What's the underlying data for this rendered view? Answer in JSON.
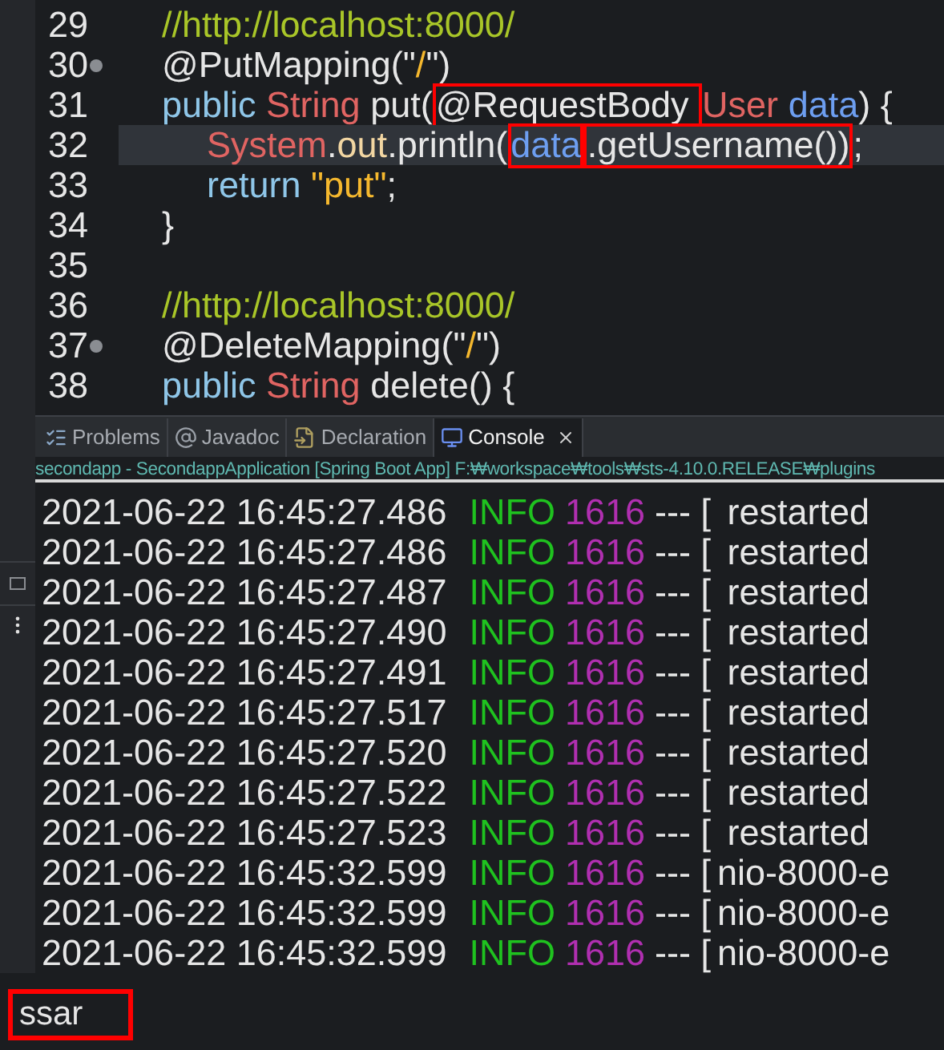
{
  "editor": {
    "lines": [
      {
        "number": "29",
        "fold": false,
        "current": false,
        "kind": "member",
        "tokens": [
          {
            "kind": "comment",
            "text": "//http://localhost:8000/",
            "boxed": false
          }
        ]
      },
      {
        "number": "30",
        "fold": true,
        "current": false,
        "kind": "member",
        "tokens": [
          {
            "kind": "plain",
            "text": "@PutMapping(",
            "boxed": false
          },
          {
            "kind": "plain",
            "text": "\"",
            "boxed": false
          },
          {
            "kind": "literal",
            "text": "/",
            "boxed": false
          },
          {
            "kind": "plain",
            "text": "\")",
            "boxed": false
          }
        ]
      },
      {
        "number": "31",
        "fold": false,
        "current": false,
        "kind": "member",
        "tokens": [
          {
            "kind": "keyword",
            "text": "public ",
            "boxed": false
          },
          {
            "kind": "type",
            "text": "String ",
            "boxed": false
          },
          {
            "kind": "plain",
            "text": "put(",
            "boxed": false
          },
          {
            "kind": "plain",
            "text": "@RequestBody ",
            "boxed": true
          },
          {
            "kind": "type",
            "text": "User ",
            "boxed": false
          },
          {
            "kind": "variable",
            "text": "data",
            "boxed": false
          },
          {
            "kind": "plain",
            "text": ") {",
            "boxed": false
          }
        ]
      },
      {
        "number": "32",
        "fold": false,
        "current": true,
        "kind": "statement",
        "tokens": [
          {
            "kind": "type",
            "text": "System",
            "boxed": false
          },
          {
            "kind": "plain",
            "text": ".",
            "boxed": false
          },
          {
            "kind": "field",
            "text": "out",
            "boxed": false
          },
          {
            "kind": "plain",
            "text": ".println(",
            "boxed": false
          },
          {
            "kind": "variable",
            "text": "data",
            "boxed": true
          },
          {
            "kind": "plain",
            "text": ".getUsername())",
            "boxed": true
          },
          {
            "kind": "plain",
            "text": ";",
            "boxed": false
          }
        ]
      },
      {
        "number": "33",
        "fold": false,
        "current": false,
        "kind": "statement",
        "tokens": [
          {
            "kind": "keyword",
            "text": "return ",
            "boxed": false
          },
          {
            "kind": "literal",
            "text": "\"put\"",
            "boxed": false
          },
          {
            "kind": "plain",
            "text": ";",
            "boxed": false
          }
        ]
      },
      {
        "number": "34",
        "fold": false,
        "current": false,
        "kind": "member",
        "tokens": [
          {
            "kind": "plain",
            "text": "}",
            "boxed": false
          }
        ]
      },
      {
        "number": "35",
        "fold": false,
        "current": false,
        "kind": "member"
      },
      {
        "number": "36",
        "fold": false,
        "current": false,
        "kind": "member",
        "tokens": [
          {
            "kind": "comment",
            "text": "//http://localhost:8000/",
            "boxed": false
          }
        ]
      },
      {
        "number": "37",
        "fold": true,
        "current": false,
        "kind": "member",
        "tokens": [
          {
            "kind": "plain",
            "text": "@DeleteMapping(",
            "boxed": false
          },
          {
            "kind": "plain",
            "text": "\"",
            "boxed": false
          },
          {
            "kind": "literal",
            "text": "/",
            "boxed": false
          },
          {
            "kind": "plain",
            "text": "\")",
            "boxed": false
          }
        ]
      },
      {
        "number": "38",
        "fold": false,
        "current": false,
        "kind": "member",
        "tokens": [
          {
            "kind": "keyword",
            "text": "public ",
            "boxed": false
          },
          {
            "kind": "type",
            "text": "String ",
            "boxed": false
          },
          {
            "kind": "plain",
            "text": "delete() {",
            "boxed": false
          }
        ]
      }
    ]
  },
  "tabs": [
    {
      "label": "Problems",
      "kind": "problems",
      "selected": false
    },
    {
      "label": "Javadoc",
      "kind": "javadoc",
      "selected": false
    },
    {
      "label": "Declaration",
      "kind": "declaration",
      "selected": false
    },
    {
      "label": "Console",
      "kind": "console",
      "selected": true
    }
  ],
  "console": {
    "launch": "secondapp - SecondappApplication [Spring Boot App] F:₩workspace₩tools₩sts-4.10.0.RELEASE₩plugins",
    "rows": [
      {
        "time": "2021-06-22 16:45:27.486",
        "level": "INFO",
        "pid": "1616",
        "sep": "--- [",
        "thread": " restarted"
      },
      {
        "time": "2021-06-22 16:45:27.486",
        "level": "INFO",
        "pid": "1616",
        "sep": "--- [",
        "thread": " restarted"
      },
      {
        "time": "2021-06-22 16:45:27.487",
        "level": "INFO",
        "pid": "1616",
        "sep": "--- [",
        "thread": " restarted"
      },
      {
        "time": "2021-06-22 16:45:27.490",
        "level": "INFO",
        "pid": "1616",
        "sep": "--- [",
        "thread": " restarted"
      },
      {
        "time": "2021-06-22 16:45:27.491",
        "level": "INFO",
        "pid": "1616",
        "sep": "--- [",
        "thread": " restarted"
      },
      {
        "time": "2021-06-22 16:45:27.517",
        "level": "INFO",
        "pid": "1616",
        "sep": "--- [",
        "thread": " restarted"
      },
      {
        "time": "2021-06-22 16:45:27.520",
        "level": "INFO",
        "pid": "1616",
        "sep": "--- [",
        "thread": " restarted"
      },
      {
        "time": "2021-06-22 16:45:27.522",
        "level": "INFO",
        "pid": "1616",
        "sep": "--- [",
        "thread": " restarted"
      },
      {
        "time": "2021-06-22 16:45:27.523",
        "level": "INFO",
        "pid": "1616",
        "sep": "--- [",
        "thread": " restarted"
      },
      {
        "time": "2021-06-22 16:45:32.599",
        "level": "INFO",
        "pid": "1616",
        "sep": "--- [",
        "thread": "nio-8000-e"
      },
      {
        "time": "2021-06-22 16:45:32.599",
        "level": "INFO",
        "pid": "1616",
        "sep": "--- [",
        "thread": "nio-8000-e"
      },
      {
        "time": "2021-06-22 16:45:32.599",
        "level": "INFO",
        "pid": "1616",
        "sep": "--- [",
        "thread": "nio-8000-e"
      }
    ],
    "output": {
      "text": "ssar",
      "boxed": true
    }
  }
}
